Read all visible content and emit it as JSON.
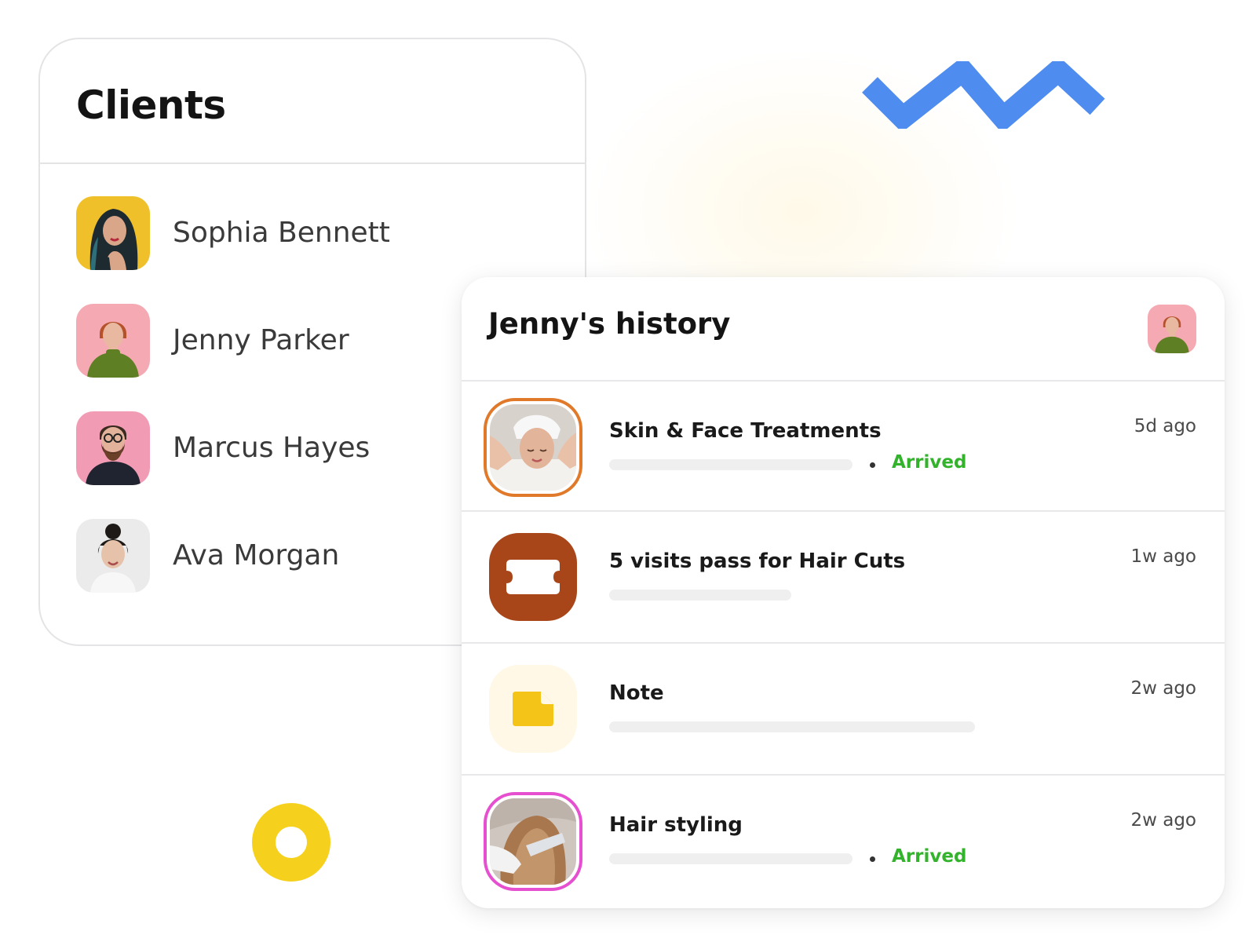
{
  "clients": {
    "title": "Clients",
    "items": [
      {
        "name": "Sophia Bennett",
        "avatar_bg": "#f0c02a"
      },
      {
        "name": "Jenny Parker",
        "avatar_bg": "#f5a9b3"
      },
      {
        "name": "Marcus Hayes",
        "avatar_bg": "#f29bb4"
      },
      {
        "name": "Ava Morgan",
        "avatar_bg": "#ebebeb"
      }
    ]
  },
  "history": {
    "title": "Jenny's history",
    "items": [
      {
        "title": "Skin & Face Treatments",
        "time": "5d ago",
        "status": "Arrived",
        "icon": "face-treatment-photo",
        "ring_color": "#e07a2a"
      },
      {
        "title": "5 visits pass for Hair Cuts",
        "time": "1w ago",
        "status": "",
        "icon": "ticket-icon",
        "icon_bg": "#a8461a"
      },
      {
        "title": "Note",
        "time": "2w ago",
        "status": "",
        "icon": "note-icon",
        "icon_bg": "#fff8e6",
        "icon_color": "#f4c418"
      },
      {
        "title": "Hair styling",
        "time": "2w ago",
        "status": "Arrived",
        "icon": "hair-styling-photo",
        "ring_color": "#e64fcf"
      }
    ]
  },
  "colors": {
    "accent_blue": "#4f8cf0",
    "accent_yellow": "#f5d11e",
    "status_green": "#33b32c"
  }
}
